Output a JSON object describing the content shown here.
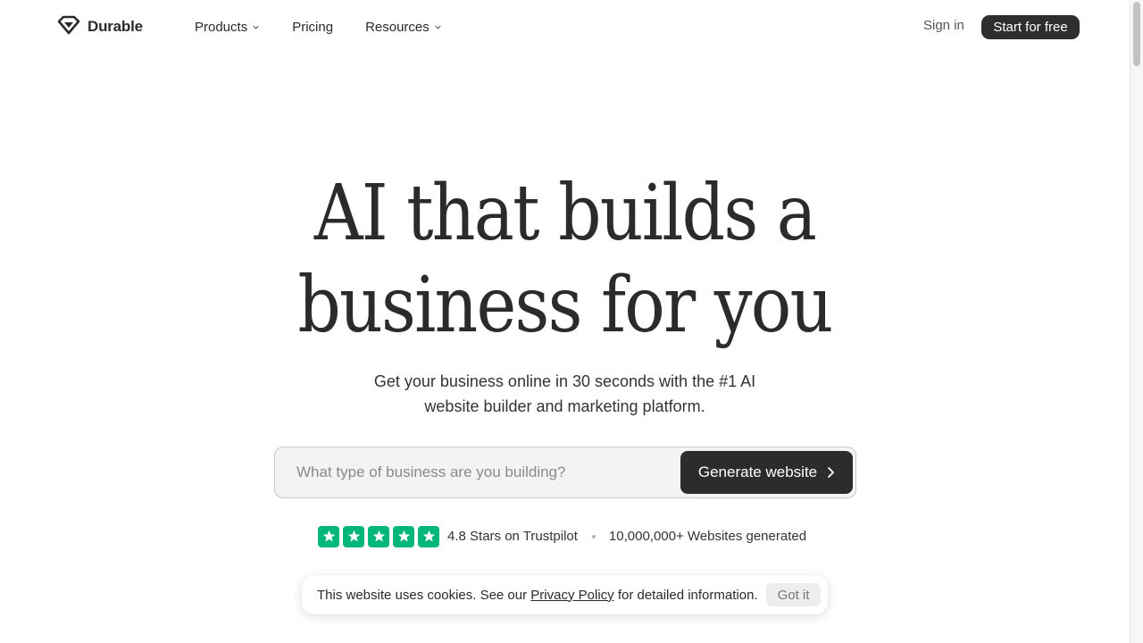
{
  "header": {
    "brand": "Durable",
    "menu": [
      {
        "label": "Products",
        "has_dropdown": true
      },
      {
        "label": "Pricing",
        "has_dropdown": false
      },
      {
        "label": "Resources",
        "has_dropdown": true
      }
    ],
    "sign_in": "Sign in",
    "cta": "Start for free"
  },
  "hero": {
    "title_line1": "AI that builds a",
    "title_line2": "business for you",
    "subtitle_line1": "Get your business online in 30 seconds with the #1 AI",
    "subtitle_line2": "website builder and marketing platform."
  },
  "form": {
    "placeholder": "What type of business are you building?",
    "value": "",
    "button": "Generate website"
  },
  "trust": {
    "stars_count": 5,
    "rating_text": "4.8 Stars on Trustpilot",
    "sites_text": "10,000,000+ Websites generated"
  },
  "cookie": {
    "text_before": "This website uses cookies. See our ",
    "link": "Privacy Policy",
    "text_after": " for detailed information.",
    "button": "Got it"
  },
  "icons": {
    "logo": "diamond-logo-icon",
    "dropdown": "chevron-down-icon",
    "arrow": "chevron-right-icon",
    "star": "star-icon"
  },
  "colors": {
    "brand_dark": "#2e2e2e",
    "trustpilot_green": "#00b67a",
    "background": "#ffffff"
  }
}
